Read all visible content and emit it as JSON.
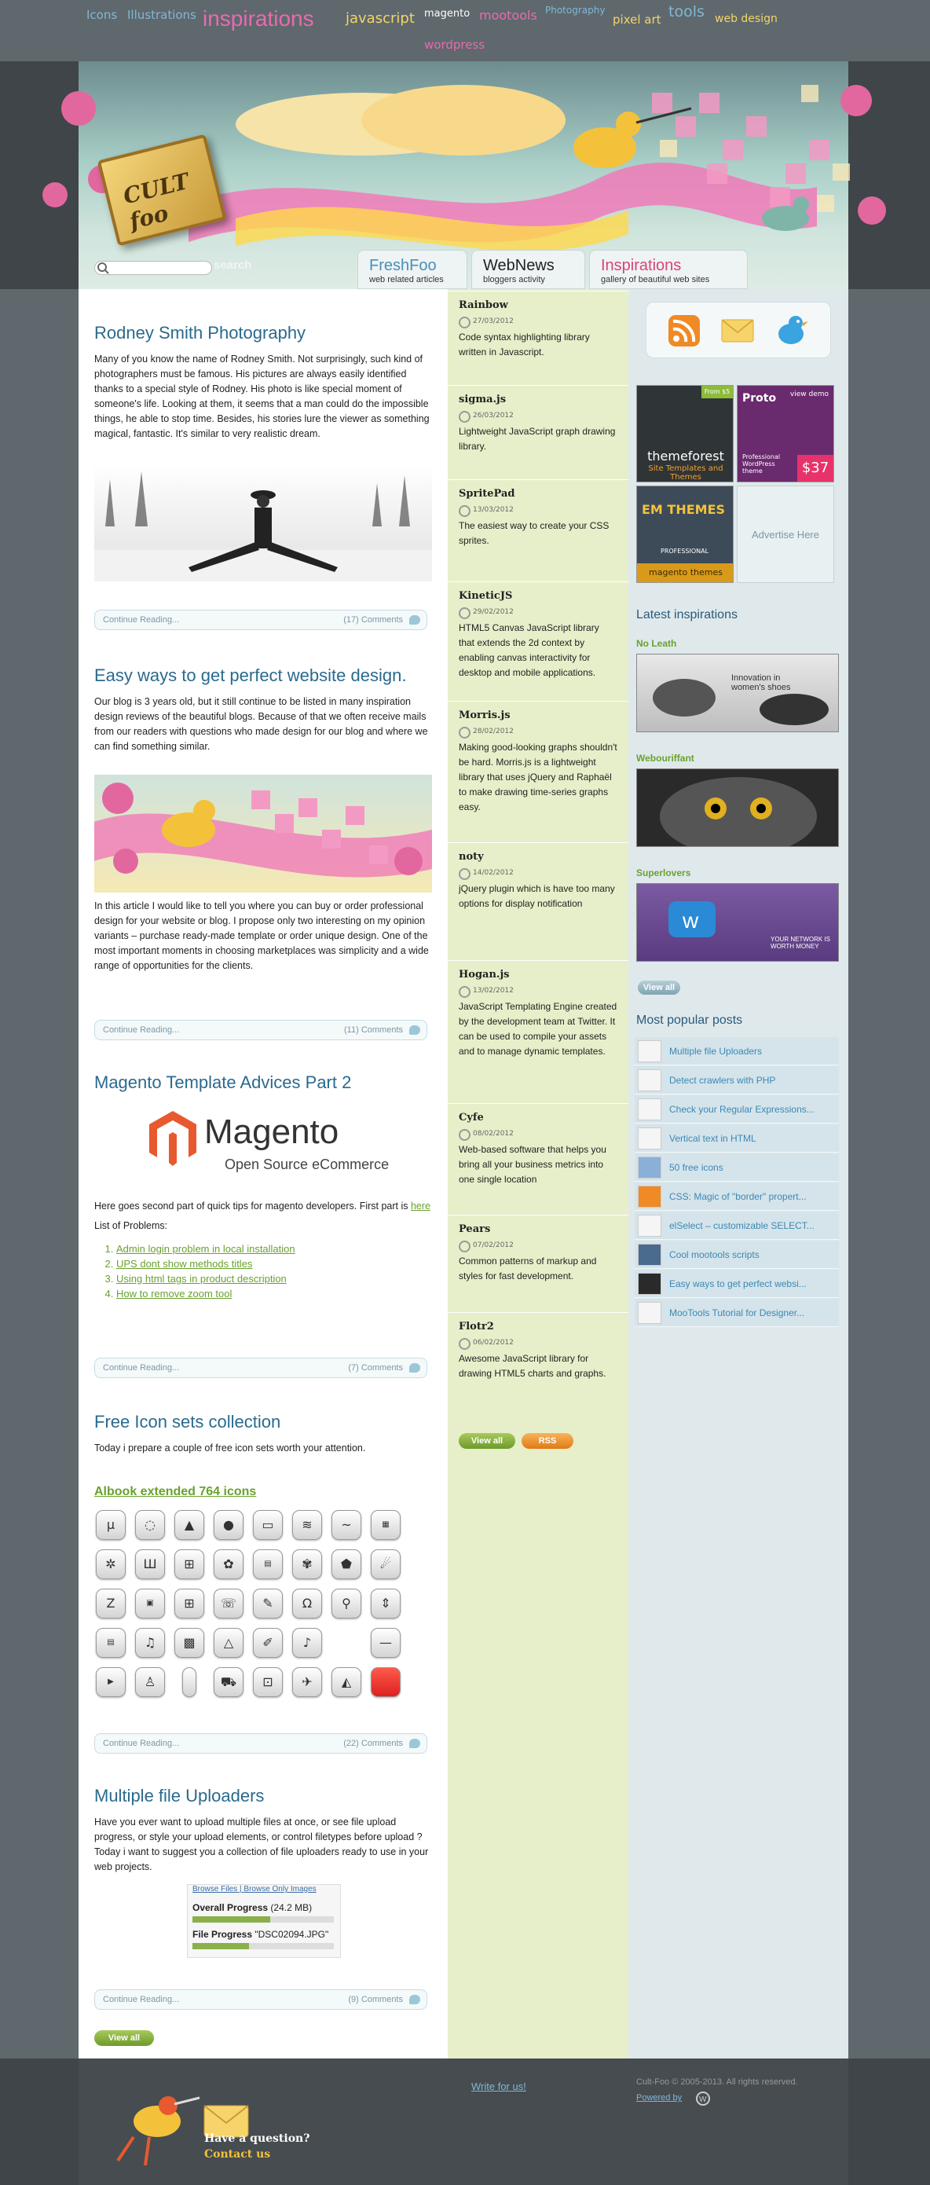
{
  "tags": [
    {
      "label": "Icons",
      "color": "#7fb8d8",
      "size": 15
    },
    {
      "label": "Illustrations",
      "color": "#7fb8d8",
      "size": 15
    },
    {
      "label": "inspirations",
      "color": "#e86ab0",
      "size": 28
    },
    {
      "label": "javascript",
      "color": "#f3d46a",
      "size": 18
    },
    {
      "label": "magento",
      "color": "#ffffff",
      "size": 13
    },
    {
      "label": "mootools",
      "color": "#e86ab0",
      "size": 16
    },
    {
      "label": "Photography",
      "color": "#7fb8d8",
      "size": 12
    },
    {
      "label": "pixel art",
      "color": "#f3d46a",
      "size": 15
    },
    {
      "label": "tools",
      "color": "#7fb8d8",
      "size": 19
    },
    {
      "label": "web design",
      "color": "#f3d46a",
      "size": 14
    },
    {
      "label": "wordpress",
      "color": "#e86ab0",
      "size": 15
    }
  ],
  "header": {
    "logo_text": "CULT foo",
    "search_label": "search",
    "tabs": [
      {
        "title": "FreshFoo",
        "subtitle": "web related articles",
        "color": "#4a8fb8"
      },
      {
        "title": "WebNews",
        "subtitle": "bloggers activity",
        "color": "#222222"
      },
      {
        "title": "Inspirations",
        "subtitle": "gallery of beautiful web sites",
        "color": "#d8447a"
      }
    ]
  },
  "articles": [
    {
      "title": "Rodney Smith Photography",
      "body": "Many of you know the name of Rodney Smith.  Not surprisingly, such kind of photographers must be famous. His pictures are always easily identified thanks to a special style of Rodney. His photo is like special moment of someone's life. Looking at them, it seems that a man could do the impossible things, he able to stop time. Besides, his stories lure the viewer as something magical, fantastic. It's similar to very realistic dream.",
      "read": "Continue Reading...",
      "comments": "(17) Comments"
    },
    {
      "title": "Easy ways to get perfect website design.",
      "body": "Our blog is 3 years old, but it still continue to be  listed in many inspiration design reviews of the beautiful blogs. Because of that we often receive mails from our readers with questions who made design for our blog and where we can find something similar.",
      "body2": "In this article I would like to tell you where you can buy or order professional design for your website or blog. I propose only two interesting on my opinion variants – purchase ready-made template or order unique design. One of the most important moments in choosing marketplaces  was   simplicity and a wide range of opportunities for the clients.",
      "read": "Continue Reading...",
      "comments": "(11) Comments"
    },
    {
      "title": "Magento Template Advices Part 2",
      "magento_word": "Magento",
      "magento_sub": "Open Source eCommerce",
      "body": "Here goes second part of quick tips for magento developers. First part is",
      "here": "here",
      "list_title": "List of Problems:",
      "list": [
        "Admin login problem in local installation",
        "UPS dont show methods titles",
        "Using html tags in product description",
        "How to remove zoom tool"
      ],
      "read": "Continue Reading...",
      "comments": "(7) Comments"
    },
    {
      "title": "Free Icon sets collection",
      "body": "Today i prepare a couple of free icon sets worth your attention.",
      "set_title": "Albook extended 764 icons",
      "read": "Continue Reading...",
      "comments": "(22) Comments"
    },
    {
      "title": "Multiple file Uploaders",
      "body": "Have you ever want to upload multiple files at once, or see file upload progress, or style your upload elements, or control filetypes before upload ? Today i want to suggest you a collection of file uploaders ready to use in your web projects.",
      "upl_link1": "Browse Files",
      "upl_link2": "Browse Only Images",
      "upl_overall": "Overall Progress",
      "upl_overall_size": "(24.2 MB)",
      "upl_file": "File Progress",
      "upl_file_name": "\"DSC02094.JPG\"",
      "read": "Continue Reading...",
      "comments": "(9) Comments"
    }
  ],
  "view_all": "View all",
  "tools": [
    {
      "name": "Rainbow",
      "date": "27/03/2012",
      "desc": "Code syntax highlighting library written in Javascript."
    },
    {
      "name": "sigma.js",
      "date": "26/03/2012",
      "desc": "Lightweight JavaScript graph drawing library."
    },
    {
      "name": "SpritePad",
      "date": "13/03/2012",
      "desc": "The easiest way to create your CSS sprites."
    },
    {
      "name": "KineticJS",
      "date": "29/02/2012",
      "desc": "HTML5 Canvas JavaScript library that extends the 2d context by enabling canvas interactivity for desktop and mobile applications."
    },
    {
      "name": "Morris.js",
      "date": "28/02/2012",
      "desc": "Making good-looking graphs shouldn't be hard. Morris.js is a lightweight library that uses jQuery and Raphaël to make drawing time-series graphs easy."
    },
    {
      "name": "noty",
      "date": "14/02/2012",
      "desc": "jQuery plugin which is have too many options for display notification"
    },
    {
      "name": "Hogan.js",
      "date": "13/02/2012",
      "desc": "JavaScript Templating Engine created by the development team at Twitter. It can be used to compile your assets and to manage dynamic templates."
    },
    {
      "name": "Cyfe",
      "date": "08/02/2012",
      "desc": "Web-based software that helps you bring all your business metrics into one single location"
    },
    {
      "name": "Pears",
      "date": "07/02/2012",
      "desc": "Common patterns of markup and styles for fast development."
    },
    {
      "name": "Flotr2",
      "date": "06/02/2012",
      "desc": "Awesome JavaScript library for drawing HTML5 charts and graphs."
    }
  ],
  "rss": "RSS",
  "ads": {
    "tf_title": "themeforest",
    "tf_sub": "Site Templates and Themes",
    "tf_badge": "From $5",
    "proto_title": "Proto",
    "proto_view": "view demo",
    "proto_sub": "Professional WordPress theme",
    "proto_price": "$37",
    "em_title": "EM THEMES",
    "em_sub": "PROFESSIONAL",
    "em_foot": "magento themes",
    "advertise": "Advertise Here"
  },
  "latest_title": "Latest inspirations",
  "latest": [
    {
      "name": "No Leath",
      "caption": "Innovation in women's shoes"
    },
    {
      "name": "Webouriffant",
      "caption": ""
    },
    {
      "name": "Superlovers",
      "caption": "YOUR NETWORK IS WORTH MONEY"
    }
  ],
  "popular_title": "Most popular posts",
  "popular": [
    "Multiple file Uploaders",
    "Detect crawlers with PHP",
    "Check your Regular Expressions...",
    "Vertical text in HTML",
    "50 free icons",
    "CSS: Magic of \"border\" propert...",
    "elSelect – customizable SELECT...",
    "Cool mootools scripts",
    "Easy ways to get perfect websi...",
    "MooTools Tutorial for Designer..."
  ],
  "footer": {
    "write": "Write for us!",
    "question": "Have a question?",
    "contact": "Contact us",
    "copyright": "Cult-Foo © 2005-2013. All rights reserved.",
    "powered": "Powered by"
  },
  "colors": {
    "accent": "#2a6a8e",
    "green": "#6aa12e",
    "pink": "#e86ab0"
  }
}
